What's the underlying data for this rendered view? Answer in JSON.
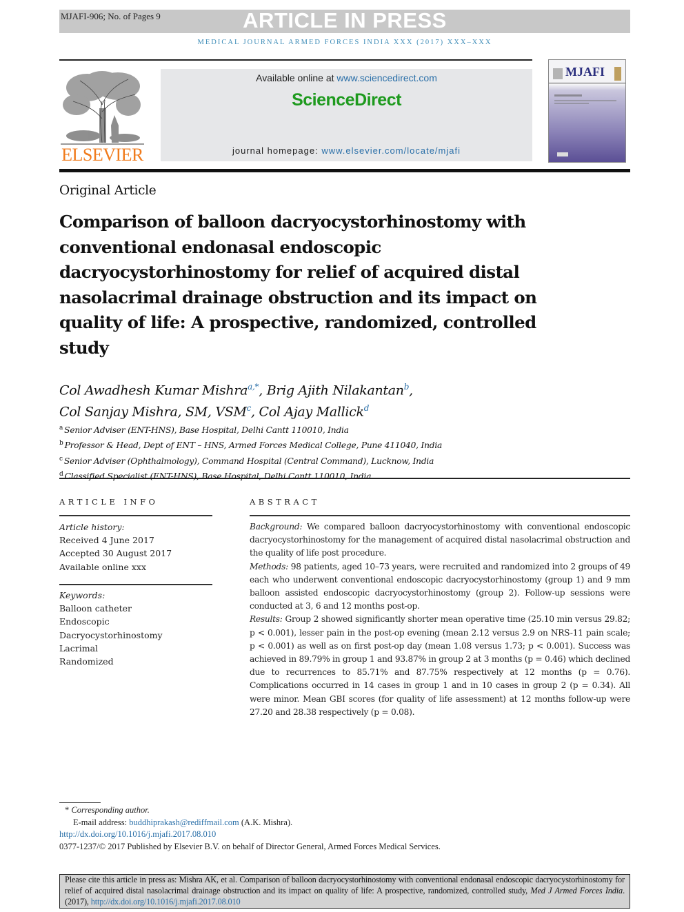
{
  "banner": {
    "manuscript_id": "MJAFI-906; No. of Pages 9",
    "status": "ARTICLE IN PRESS",
    "journal_line": "MEDICAL JOURNAL ARMED FORCES INDIA XXX (2017) XXX–XXX"
  },
  "header": {
    "publisher_logo_text": "ELSEVIER",
    "available_online_prefix": "Available online at ",
    "available_online_link": "www.sciencedirect.com",
    "platform_name": "ScienceDirect",
    "homepage_prefix": "journal homepage: ",
    "homepage_link": "www.elsevier.com/locate/mjafi",
    "cover_title": "MJAFI"
  },
  "article": {
    "type": "Original Article",
    "title": "Comparison of balloon dacryocystorhinostomy with conventional endonasal endoscopic dacryocystorhinostomy for relief of acquired distal nasolacrimal drainage obstruction and its impact on quality of life: A prospective, randomized, controlled study",
    "authors": [
      {
        "name": "Col Awadhesh Kumar Mishra",
        "affil": "a,*",
        "sep": ", "
      },
      {
        "name": "Brig Ajith Nilakantan",
        "affil": "b",
        "sep": ","
      },
      {
        "name": "Col Sanjay Mishra, SM, VSM",
        "affil": "c",
        "sep": ", "
      },
      {
        "name": "Col Ajay Mallick",
        "affil": "d",
        "sep": ""
      }
    ],
    "affiliations": [
      {
        "key": "a",
        "text": "Senior Adviser (ENT-HNS), Base Hospital, Delhi Cantt 110010, India"
      },
      {
        "key": "b",
        "text": "Professor & Head, Dept of ENT – HNS, Armed Forces Medical College, Pune 411040, India"
      },
      {
        "key": "c",
        "text": "Senior Adviser (Ophthalmology), Command Hospital (Central Command), Lucknow, India"
      },
      {
        "key": "d",
        "text": "Classified Specialist (ENT-HNS), Base Hospital, Delhi Cantt 110010, India"
      }
    ]
  },
  "article_info": {
    "heading": "ARTICLE INFO",
    "history_label": "Article history:",
    "history": [
      "Received 4 June 2017",
      "Accepted 30 August 2017",
      "Available online xxx"
    ],
    "keywords_label": "Keywords:",
    "keywords": [
      "Balloon catheter",
      "Endoscopic",
      "Dacryocystorhinostomy",
      "Lacrimal",
      "Randomized"
    ]
  },
  "abstract": {
    "heading": "ABSTRACT",
    "sections": [
      {
        "label": "Background:",
        "text": " We compared balloon dacryocystorhinostomy with conventional endoscopic dacryocystorhinostomy for the management of acquired distal nasolacrimal obstruction and the quality of life post procedure."
      },
      {
        "label": "Methods:",
        "text": " 98 patients, aged 10–73 years, were recruited and randomized into 2 groups of 49 each who underwent conventional endoscopic dacryocystorhinostomy (group 1) and 9 mm balloon assisted endoscopic dacryocystorhinostomy (group 2). Follow-up sessions were conducted at 3, 6 and 12 months post-op."
      },
      {
        "label": "Results:",
        "text": " Group 2 showed significantly shorter mean operative time (25.10 min versus 29.82; p < 0.001), lesser pain in the post-op evening (mean 2.12 versus 2.9 on NRS-11 pain scale; p < 0.001) as well as on first post-op day (mean 1.08 versus 1.73; p < 0.001). Success was achieved in 89.79% in group 1 and 93.87% in group 2 at 3 months (p = 0.46) which declined due to recurrences to 85.71% and 87.75% respectively at 12 months (p = 0.76). Complications occurred in 14 cases in group 1 and in 10 cases in group 2 (p = 0.34). All were minor. Mean GBI scores (for quality of life assessment) at 12 months follow-up were 27.20 and 28.38 respectively (p = 0.08)."
      }
    ]
  },
  "footnotes": {
    "corresponding_marker": "*",
    "corresponding_label": "Corresponding author.",
    "email_prefix": "E-mail address: ",
    "email": "buddhiprakash@rediffmail.com",
    "email_suffix": " (A.K. Mishra).",
    "doi": "http://dx.doi.org/10.1016/j.mjafi.2017.08.010",
    "copyright": "0377-1237/© 2017 Published by Elsevier B.V. on behalf of Director General, Armed Forces Medical Services."
  },
  "citation": {
    "text": "Please cite this article in press as: Mishra AK, et al. Comparison of balloon dacryocystorhinostomy with conventional endonasal endoscopic dacryocystorhinostomy for relief of acquired distal nasolacrimal drainage obstruction and its impact on quality of life: A prospective, randomized, controlled study, ",
    "journal": "Med J Armed Forces India",
    "year": ". (2017), ",
    "doi": "http://dx.doi.org/10.1016/j.mjafi.2017.08.010"
  },
  "colors": {
    "banner_bg": "#c8c8c8",
    "link": "#2a6fa8",
    "sciencedirect_green": "#1e9a1e",
    "elsevier_orange": "#f07b1c",
    "journal_line": "#3f8db8"
  }
}
